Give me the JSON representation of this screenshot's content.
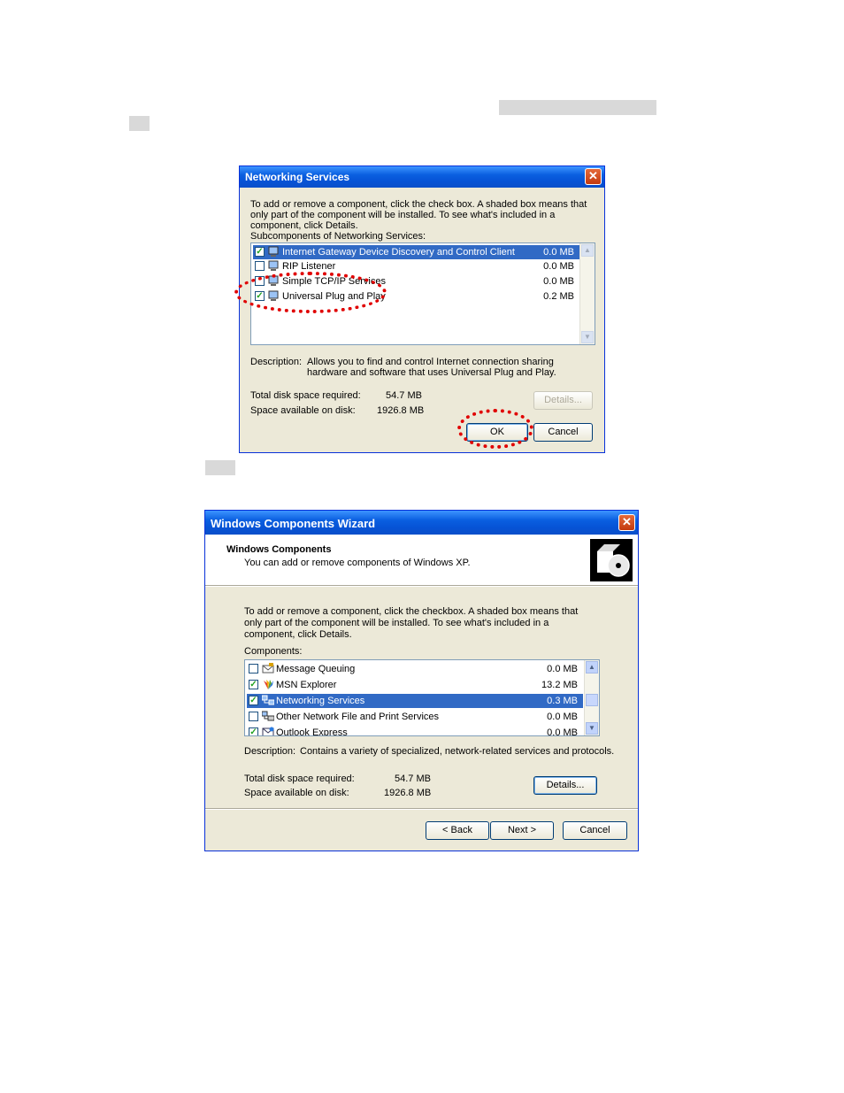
{
  "dialog1": {
    "title": "Networking Services",
    "instructions": "To add or remove a component, click the check box. A shaded box means that only part of the component will be installed. To see what's included in a component, click Details.",
    "subcomponents_label": "Subcomponents of Networking Services:",
    "items": [
      {
        "label": "Internet Gateway Device Discovery and Control Client",
        "size": "0.0 MB",
        "checked": true,
        "selected": true
      },
      {
        "label": "RIP Listener",
        "size": "0.0 MB",
        "checked": false,
        "selected": false
      },
      {
        "label": "Simple TCP/IP Services",
        "size": "0.0 MB",
        "checked": false,
        "selected": false
      },
      {
        "label": "Universal Plug and Play",
        "size": "0.2 MB",
        "checked": true,
        "selected": false
      }
    ],
    "description_label": "Description:",
    "description_text": "Allows you to find and control Internet connection sharing hardware and software that uses Universal Plug and Play.",
    "disk_required_label": "Total disk space required:",
    "disk_required_value": "54.7 MB",
    "disk_available_label": "Space available on disk:",
    "disk_available_value": "1926.8 MB",
    "details_button": "Details...",
    "ok_button": "OK",
    "cancel_button": "Cancel"
  },
  "dialog2": {
    "title": "Windows Components Wizard",
    "header_title": "Windows Components",
    "header_subtitle": "You can add or remove components of Windows XP.",
    "instructions": "To add or remove a component, click the checkbox. A shaded box means that only part of the component will be installed.  To see what's included in a component, click Details.",
    "components_label": "Components:",
    "items": [
      {
        "label": "Message Queuing",
        "size": "0.0 MB",
        "checked": false,
        "selected": false
      },
      {
        "label": "MSN Explorer",
        "size": "13.2 MB",
        "checked": true,
        "selected": false
      },
      {
        "label": "Networking Services",
        "size": "0.3 MB",
        "checked": true,
        "selected": true
      },
      {
        "label": "Other Network File and Print Services",
        "size": "0.0 MB",
        "checked": false,
        "selected": false
      },
      {
        "label": "Outlook Express",
        "size": "0.0 MB",
        "checked": true,
        "selected": false
      }
    ],
    "description_label": "Description:",
    "description_text": "Contains a variety of specialized, network-related services and protocols.",
    "disk_required_label": "Total disk space required:",
    "disk_required_value": "54.7 MB",
    "disk_available_label": "Space available on disk:",
    "disk_available_value": "1926.8 MB",
    "details_button": "Details...",
    "back_button": "< Back",
    "next_button": "Next >",
    "cancel_button": "Cancel"
  },
  "colors": {
    "highlight": "#316ac5",
    "annotation": "#e00000",
    "xp_title": "#0a5fe0"
  }
}
